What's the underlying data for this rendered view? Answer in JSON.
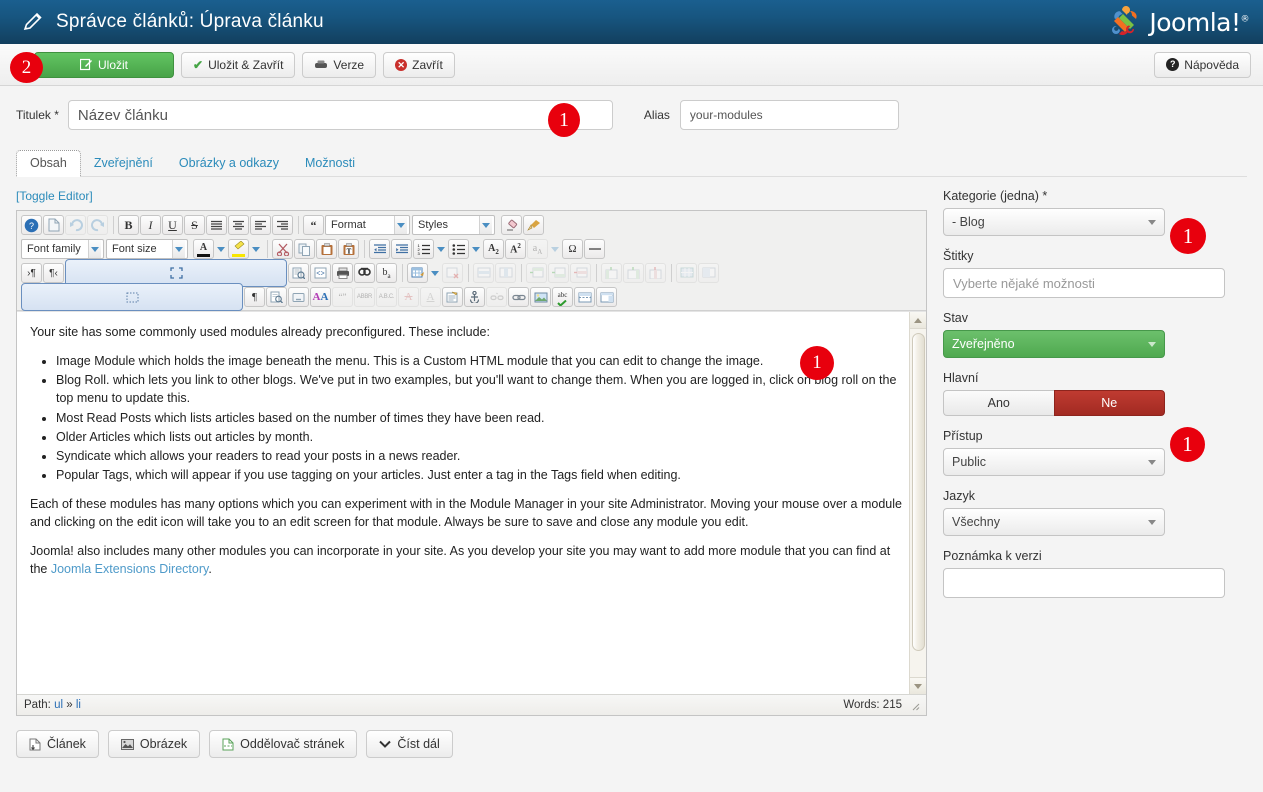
{
  "header": {
    "title": "Správce článků: Úprava článku",
    "brand": "Joomla!",
    "brand_sup": "®",
    "pencil_icon": "pencil-icon"
  },
  "toolbar": {
    "save": "Uložit",
    "save_close": "Uložit & Zavřít",
    "versions": "Verze",
    "close": "Zavřít",
    "help": "Nápověda"
  },
  "form": {
    "title_label": "Titulek *",
    "title_value": "Název článku",
    "alias_label": "Alias",
    "alias_value": "your-modules"
  },
  "tabs": [
    {
      "label": "Obsah",
      "active": true
    },
    {
      "label": "Zveřejnění",
      "active": false
    },
    {
      "label": "Obrázky a odkazy",
      "active": false
    },
    {
      "label": "Možnosti",
      "active": false
    }
  ],
  "editor": {
    "toggle_label": "[Toggle Editor]",
    "format_select": "Format",
    "styles_select": "Styles",
    "fontfamily_select": "Font family",
    "fontsize_select": "Font size",
    "path_prefix": "Path:",
    "path_value_1": "ul",
    "path_sep": "»",
    "path_value_2": "li",
    "words": "Words: 215",
    "content": {
      "intro": "Your site has some commonly used modules already preconfigured. These include:",
      "bullets": [
        "Image Module which holds the image beneath the menu. This is a Custom HTML module that you can edit to change the image.",
        "Blog Roll. which lets you link to other blogs. We've put in two examples, but you'll want to change them. When you are logged in, click on blog roll on the top menu to update this.",
        "Most Read Posts which lists articles based on the number of times they have been read.",
        "Older Articles which lists out articles by month.",
        "Syndicate which allows your readers to read your posts in a news reader.",
        "Popular Tags, which will appear if you use tagging on your articles. Just enter a tag in the Tags field when editing."
      ],
      "para2": "Each of these modules has many options which you can experiment with in the Module Manager in your site Administrator. Moving your mouse over a module and clicking on the edit icon will take you to an edit screen for that module. Always be sure to save and close any module you edit.",
      "para3_pre": "Joomla! also includes many other modules you can incorporate in your site. As you develop your site you may want to add more module that you can find at the ",
      "para3_link": "Joomla Extensions Directory",
      "para3_post": "."
    }
  },
  "bottom_buttons": [
    {
      "label": "Článek",
      "icon": "article-icon"
    },
    {
      "label": "Obrázek",
      "icon": "image-icon"
    },
    {
      "label": "Oddělovač stránek",
      "icon": "pagebreak-icon"
    },
    {
      "label": "Číst dál",
      "icon": "readmore-icon"
    }
  ],
  "sidebar": {
    "category_label": "Kategorie (jedna) *",
    "category_value": "- Blog",
    "tags_label": "Štitky",
    "tags_placeholder": "Vyberte nějaké možnosti",
    "status_label": "Stav",
    "status_value": "Zveřejněno",
    "featured_label": "Hlavní",
    "featured_yes": "Ano",
    "featured_no": "Ne",
    "access_label": "Přístup",
    "access_value": "Public",
    "language_label": "Jazyk",
    "language_value": "Všechny",
    "versionnote_label": "Poznámka k verzi",
    "versionnote_value": ""
  },
  "badges": {
    "save": "2",
    "title": "1",
    "editor": "1",
    "category": "1",
    "featured": "1"
  },
  "colors": {
    "header_blue": "#17557f",
    "save_green": "#4fa94f",
    "badge_red": "#e8000d",
    "link_blue": "#2b8bba",
    "danger_red": "#a22a22"
  }
}
